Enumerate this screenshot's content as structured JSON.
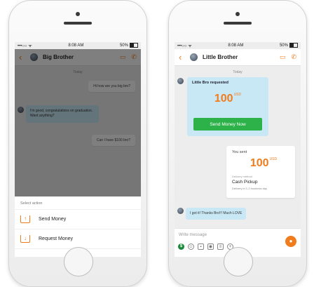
{
  "left": {
    "status": {
      "time": "8:08 AM",
      "signal": "•••○○ ᯤ",
      "battery": "50%"
    },
    "header": {
      "name": "Big Brother"
    },
    "date_divider": "Today",
    "messages": [
      {
        "from": "me",
        "text": "Hi how are you big bro?"
      },
      {
        "from": "them",
        "text": "I'm good, congratulations on graduation. Want anything?"
      },
      {
        "from": "me",
        "text": "Can I have $100 bro?"
      }
    ],
    "sheet": {
      "title": "Select action",
      "actions": [
        {
          "label": "Send Money",
          "icon": "send-money-icon"
        },
        {
          "label": "Request Money",
          "icon": "request-money-icon"
        }
      ]
    }
  },
  "right": {
    "status": {
      "time": "8:08 AM",
      "signal": "•••○○ ᯤ",
      "battery": "50%"
    },
    "header": {
      "name": "Little Brother"
    },
    "date_divider": "Today",
    "request_card": {
      "title": "Little Bro requested",
      "amount": "100",
      "currency": "USD",
      "button": "Send Money Now"
    },
    "sent_card": {
      "label": "You sent",
      "amount": "100",
      "currency": "USD",
      "method_label": "Delivery method",
      "method": "Cash Pickup",
      "delivery": "Delivery in 1-2 business day"
    },
    "reply": {
      "text": "I got it! Thanks Bro!!! Much LOVE"
    },
    "composer": {
      "placeholder": "Write message"
    }
  },
  "colors": {
    "accent": "#f07c1e",
    "bubble_in": "#c9e8f6",
    "send_button": "#2db24a"
  }
}
